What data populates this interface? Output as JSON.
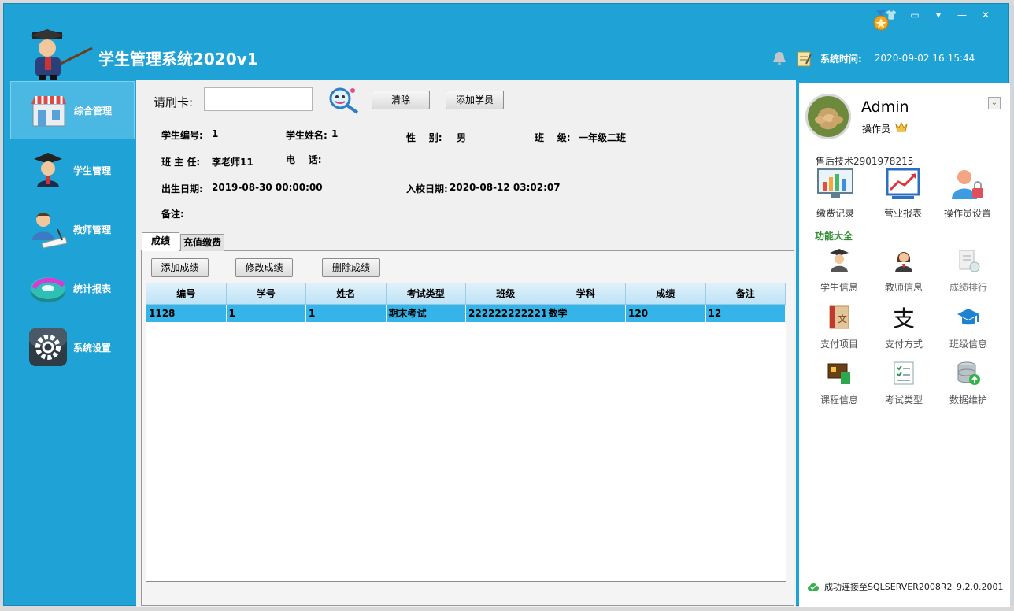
{
  "app": {
    "title": "学生管理系统2020v1",
    "system_time_label": "系统时间:",
    "system_time_value": "2020-09-02 16:15:44"
  },
  "sidebar": {
    "items": [
      {
        "label": "综合管理",
        "icon": "storefront-icon",
        "active": true
      },
      {
        "label": "学生管理",
        "icon": "graduate-icon",
        "active": false
      },
      {
        "label": "教师管理",
        "icon": "teacher-icon",
        "active": false
      },
      {
        "label": "统计报表",
        "icon": "chart-disc-icon",
        "active": false
      },
      {
        "label": "系统设置",
        "icon": "gear-icon",
        "active": false
      }
    ]
  },
  "card": {
    "label": "请刷卡:",
    "value": "",
    "clear_button": "清除",
    "add_student_button": "添加学员"
  },
  "student": {
    "id_label": "学生编号:",
    "id_value": "1",
    "name_label": "学生姓名:",
    "name_value": "1",
    "gender_label": "性    别:",
    "gender_value": "男",
    "class_label": "班    级:",
    "class_value": "一年级二班",
    "head_teacher_label": "班 主 任:",
    "head_teacher_value": "李老师11",
    "phone_label": "电    话:",
    "phone_value": "",
    "birth_label": "出生日期:",
    "birth_value": "2019-08-30 00:00:00",
    "enroll_label": "入校日期:",
    "enroll_value": "2020-08-12 03:02:07",
    "remark_label": "备注:",
    "remark_value": ""
  },
  "tabs": [
    {
      "label": "成绩",
      "active": true
    },
    {
      "label": "充值缴费",
      "active": false
    }
  ],
  "grade_actions": {
    "add": "添加成绩",
    "edit": "修改成绩",
    "delete": "删除成绩"
  },
  "grid": {
    "columns": [
      "编号",
      "学号",
      "姓名",
      "考试类型",
      "班级",
      "学科",
      "成绩",
      "备注"
    ],
    "rows": [
      [
        "1128",
        "1",
        "1",
        "期末考试",
        "222222222221",
        "数学",
        "120",
        "12"
      ]
    ]
  },
  "user": {
    "name": "Admin",
    "role": "操作员"
  },
  "support_text": "售后技术2901978215",
  "tools": [
    {
      "label": "缴费记录",
      "icon": "monitor-chart-icon"
    },
    {
      "label": "营业报表",
      "icon": "trend-report-icon"
    },
    {
      "label": "操作员设置",
      "icon": "user-lock-icon"
    }
  ],
  "functions_title": "功能大全",
  "functions": [
    {
      "label": "学生信息",
      "icon": "student-icon"
    },
    {
      "label": "教师信息",
      "icon": "teacher-info-icon"
    },
    {
      "label": "成绩排行",
      "icon": "ranking-doc-icon"
    },
    {
      "label": "支付项目",
      "icon": "payment-book-icon"
    },
    {
      "label": "支付方式",
      "icon": "alipay-icon"
    },
    {
      "label": "班级信息",
      "icon": "class-cap-icon"
    },
    {
      "label": "课程信息",
      "icon": "course-board-icon"
    },
    {
      "label": "考试类型",
      "icon": "checklist-icon"
    },
    {
      "label": "数据维护",
      "icon": "database-icon"
    }
  ],
  "status": {
    "connection": "成功连接至SQLSERVER2008R2",
    "version": "9.2.0.2001"
  },
  "colors": {
    "app_blue": "#1fa3d6",
    "selected_row": "#35b4ea",
    "section_green": "#2e8b2e"
  }
}
